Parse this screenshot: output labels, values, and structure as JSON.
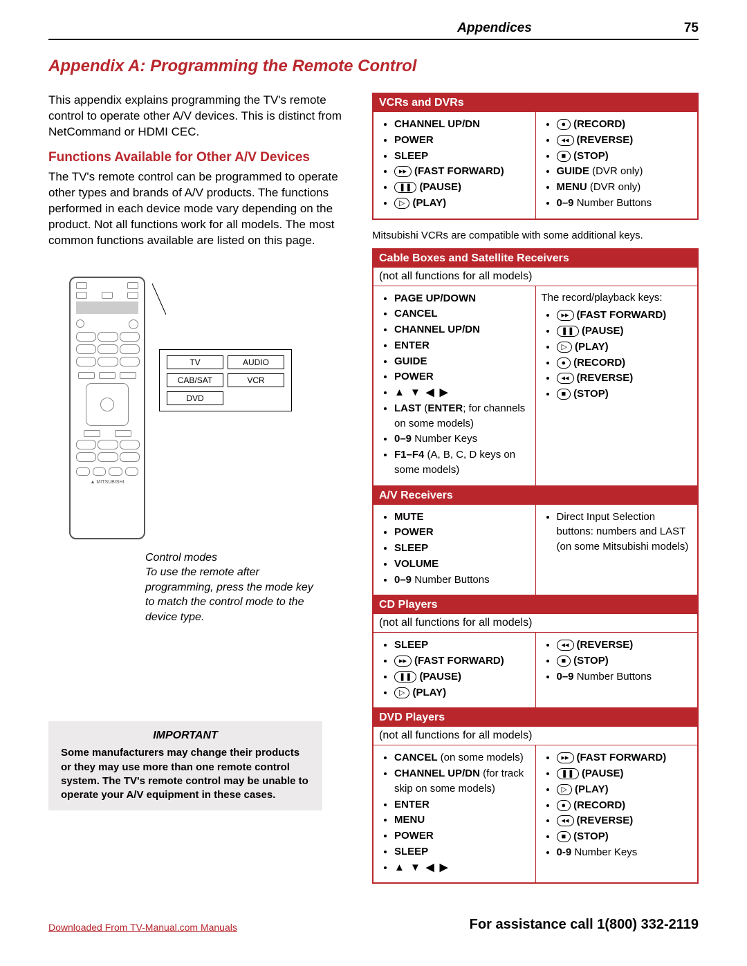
{
  "header": {
    "section": "Appendices",
    "page_number": "75"
  },
  "title": "Appendix A:  Programming the Remote Control",
  "intro": "This appendix explains programming the TV's remote control to operate other A/V devices.  This is distinct from NetCommand or HDMI CEC.",
  "subhead": "Functions Available for Other A/V Devices",
  "subhead_text": "The TV's remote control can be programmed to operate other types and brands of A/V products. The functions performed in each device mode vary depending on the product.  Not all functions work for all models. The most common functions available are listed on this page.",
  "remote_brand": "▲ MITSUBISHI",
  "mode_buttons": [
    "TV",
    "AUDIO",
    "CAB/SAT",
    "DVD",
    "VCR"
  ],
  "caption": {
    "title": "Control modes",
    "text": "To use the remote after programming, press the mode key to match the control mode to the device type."
  },
  "important": {
    "title": "IMPORTANT",
    "text": "Some manufacturers may change their products or they may use more than one remote control system.  The TV's remote control may be unable to operate your A/V equipment in these cases."
  },
  "icon_glyphs": {
    "record": "●",
    "reverse": "◂◂",
    "stop": "■",
    "fast_forward": "▸▸",
    "pause": "❚❚",
    "play": "▷"
  },
  "arrows_glyph": "▲ ▼ ◀ ▶",
  "tables": {
    "vcr": {
      "header": "VCRs and DVRs",
      "left": [
        {
          "t": "CHANNEL UP/DN",
          "b": true
        },
        {
          "t": "POWER",
          "b": true
        },
        {
          "t": "SLEEP",
          "b": true
        },
        {
          "icon": "fast_forward",
          "t": "(FAST FORWARD)",
          "b": true
        },
        {
          "icon": "pause",
          "t": "(PAUSE)",
          "b": true
        },
        {
          "icon": "play",
          "t": "(PLAY)",
          "b": true
        }
      ],
      "right": [
        {
          "icon": "record",
          "t": "(RECORD)",
          "b": true
        },
        {
          "icon": "reverse",
          "t": "(REVERSE)",
          "b": true
        },
        {
          "icon": "stop",
          "t": "(STOP)",
          "b": true
        },
        {
          "t": "GUIDE",
          "tail": " (DVR only)",
          "b": true
        },
        {
          "t": "MENU",
          "tail": " (DVR only)",
          "b": true
        },
        {
          "t": "0–9",
          "tail": " Number Buttons",
          "b": true
        }
      ]
    },
    "mits_note": "Mitsubishi VCRs are compatible with some additional keys.",
    "cable": {
      "header": "Cable Boxes and Satellite Receivers",
      "note": "(not all functions for all models)",
      "left": [
        {
          "t": "PAGE UP/DOWN",
          "b": true
        },
        {
          "t": "CANCEL",
          "b": true
        },
        {
          "t": "CHANNEL UP/DN",
          "b": true
        },
        {
          "t": "ENTER",
          "b": true
        },
        {
          "t": "GUIDE",
          "b": true
        },
        {
          "t": "POWER",
          "b": true
        },
        {
          "t": "",
          "arrows": true
        },
        {
          "t": "LAST",
          "b": true,
          "tail": " (ENTER; for channels on some models)",
          "tail_b": false,
          "tail_mixed": true
        },
        {
          "t": "0–9",
          "tail": " Number Keys",
          "b": true
        },
        {
          "t": "F1–F4",
          "tail": " (A, B, C, D keys on some models)",
          "b": true
        }
      ],
      "right_intro": "The record/playback keys:",
      "right": [
        {
          "icon": "fast_forward",
          "t": "(FAST FORWARD)",
          "b": true
        },
        {
          "icon": "pause",
          "t": "(PAUSE)",
          "b": true
        },
        {
          "icon": "play",
          "t": "(PLAY)",
          "b": true
        },
        {
          "icon": "record",
          "t": "(RECORD)",
          "b": true
        },
        {
          "icon": "reverse",
          "t": "(REVERSE)",
          "b": true
        },
        {
          "icon": "stop",
          "t": "(STOP)",
          "b": true
        }
      ]
    },
    "avr": {
      "header": "A/V Receivers",
      "left": [
        {
          "t": "MUTE",
          "b": true
        },
        {
          "t": "POWER",
          "b": true
        },
        {
          "t": "SLEEP",
          "b": true
        },
        {
          "t": "VOLUME",
          "b": true
        },
        {
          "t": "0–9",
          "tail": " Number Buttons",
          "b": true
        }
      ],
      "right_plain": "Direct Input Selection buttons:  numbers and LAST (on some Mitsubishi models)"
    },
    "cd": {
      "header": "CD Players",
      "note": "(not all functions for all models)",
      "left": [
        {
          "t": "SLEEP",
          "b": true
        },
        {
          "icon": "fast_forward",
          "t": "(FAST FORWARD)",
          "b": true
        },
        {
          "icon": "pause",
          "t": "(PAUSE)",
          "b": true
        },
        {
          "icon": "play",
          "t": "(PLAY)",
          "b": true
        }
      ],
      "right": [
        {
          "icon": "reverse",
          "t": "(REVERSE)",
          "b": true
        },
        {
          "icon": "stop",
          "t": "(STOP)",
          "b": true
        },
        {
          "t": "0–9",
          "tail": " Number Buttons",
          "b": true
        }
      ]
    },
    "dvd": {
      "header": "DVD Players",
      "note": "(not all functions for all models)",
      "left": [
        {
          "t": "CANCEL",
          "tail": " (on some models)",
          "b": true
        },
        {
          "t": "CHANNEL UP/DN",
          "tail": " (for track skip on some models)",
          "b": true
        },
        {
          "t": "ENTER",
          "b": true
        },
        {
          "t": "MENU",
          "b": true
        },
        {
          "t": "POWER",
          "b": true
        },
        {
          "t": "SLEEP",
          "b": true
        },
        {
          "t": "",
          "arrows": true
        }
      ],
      "right": [
        {
          "icon": "fast_forward",
          "t": "(FAST FORWARD)",
          "b": true
        },
        {
          "icon": "pause",
          "t": "(PAUSE)",
          "b": true
        },
        {
          "icon": "play",
          "t": "(PLAY)",
          "b": true
        },
        {
          "icon": "record",
          "t": "(RECORD)",
          "b": true
        },
        {
          "icon": "reverse",
          "t": "(REVERSE)",
          "b": true
        },
        {
          "icon": "stop",
          "t": "(STOP)",
          "b": true
        },
        {
          "t": "0-9",
          "tail": " Number Keys",
          "b": true
        }
      ]
    }
  },
  "footer": {
    "download": "Downloaded From TV-Manual.com Manuals",
    "assistance": "For assistance call 1(800) 332-2119"
  }
}
